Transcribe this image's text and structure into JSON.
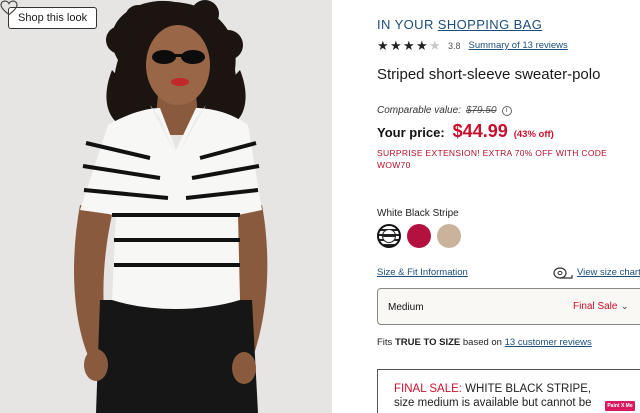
{
  "photo": {
    "shop_button": "Shop this look",
    "favorite_icon": "heart-outline-icon"
  },
  "bag": {
    "prefix": "IN YOUR",
    "link": "SHOPPING BAG"
  },
  "rating": {
    "stars_filled": 4,
    "stars_total": 5,
    "value": "3.8",
    "reviews_link": "Summary of 13 reviews"
  },
  "product": {
    "title": "Striped short-sleeve sweater-polo"
  },
  "pricing": {
    "comparable_label": "Comparable value:",
    "comparable_value": "$79.50",
    "your_price_label": "Your price:",
    "your_price": "$44.99",
    "discount": "(43% off)",
    "promo": "SURPRISE EXTENSION! EXTRA 70% OFF WITH CODE WOW70"
  },
  "color": {
    "selected_name": "White Black Stripe",
    "swatches": [
      {
        "name": "White Black Stripe",
        "hex": "#ffffff",
        "selected": true
      },
      {
        "name": "red",
        "hex": "#b3123e",
        "selected": false
      },
      {
        "name": "tan",
        "hex": "#c9b49b",
        "selected": false
      }
    ]
  },
  "size": {
    "fit_info_link": "Size & Fit Information",
    "size_chart_link": "View size chart",
    "selected_value": "Medium",
    "selected_note": "Final Sale"
  },
  "fit": {
    "prefix": "Fits",
    "bold": "TRUE TO SIZE",
    "middle": "based on",
    "link": "13 customer reviews"
  },
  "final_sale": {
    "label": "FINAL SALE:",
    "text": "WHITE BLACK STRIPE, size medium is available but cannot be"
  },
  "badge": "Paint X Me",
  "colors": {
    "link_blue": "#1f4d7a",
    "sale_red": "#c8102e",
    "promo_red": "#b0102a"
  }
}
